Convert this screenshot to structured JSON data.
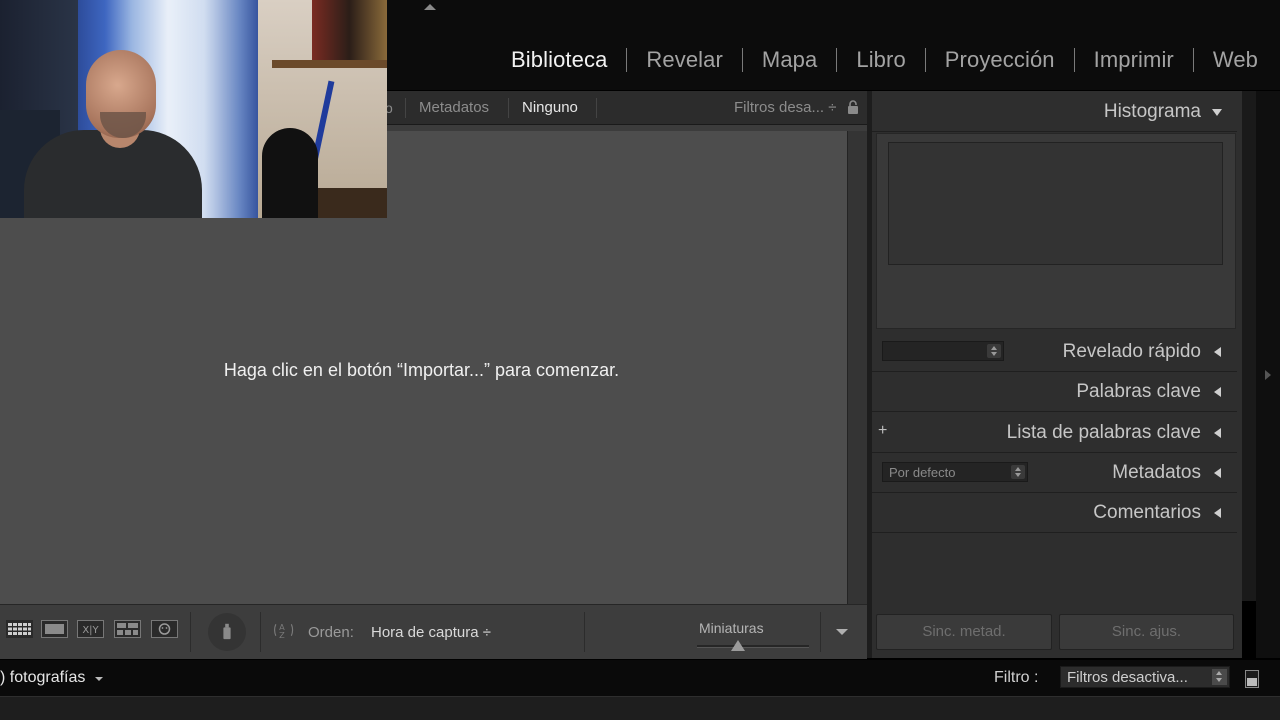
{
  "modules": [
    "Biblioteca",
    "Revelar",
    "Mapa",
    "Libro",
    "Proyección",
    "Imprimir",
    "Web"
  ],
  "active_module": "Biblioteca",
  "filter_bar": {
    "partial_item": "o",
    "items": [
      "Metadatos",
      "Ninguno"
    ],
    "active": "Ninguno",
    "filters_label": "Filtros desa... ÷"
  },
  "content": {
    "empty_message": "Haga clic en el botón “Importar...” para comenzar."
  },
  "toolbar": {
    "sort_label": "Orden:",
    "sort_value": "Hora de captura ÷",
    "thumbnails_label": "Miniaturas",
    "thumbnail_size_fraction": 0.37
  },
  "right_panel": {
    "histogram_title": "Histograma",
    "quick_develop_title": "Revelado rápido",
    "keywording_title": "Palabras clave",
    "keyword_list_title": "Lista de palabras clave",
    "metadata_title": "Metadatos",
    "metadata_preset": "Por defecto",
    "comments_title": "Comentarios",
    "sync_metadata_label": "Sinc. metad.",
    "sync_settings_label": "Sinc. ajus."
  },
  "bottom_bar": {
    "photos_count": ") fotografías",
    "filter_label": "Filtro :",
    "filter_value": "Filtros desactiva..."
  },
  "colors": {
    "background": "#000000",
    "content_gray": "#4d4d4d",
    "panel_gray": "#2e2e2e",
    "active_text": "#f2f2f2",
    "inactive_text": "#a3a3a3"
  }
}
